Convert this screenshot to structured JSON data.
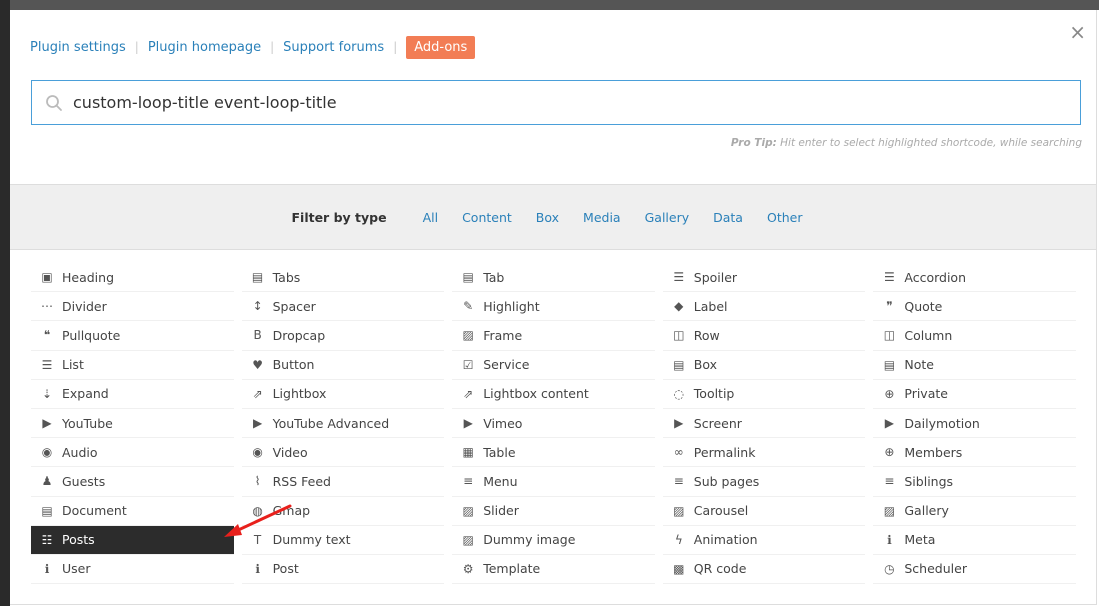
{
  "header": {
    "links": [
      "Plugin settings",
      "Plugin homepage",
      "Support forums"
    ],
    "addons_label": "Add-ons",
    "close_glyph": "×"
  },
  "search": {
    "value": "custom-loop-title event-loop-title",
    "icon": "search-icon"
  },
  "protip": {
    "bold": "Pro Tip:",
    "text": " Hit enter to select highlighted shortcode, while searching"
  },
  "filter": {
    "label": "Filter by type",
    "types": [
      "All",
      "Content",
      "Box",
      "Media",
      "Gallery",
      "Data",
      "Other"
    ]
  },
  "colors": {
    "link": "#2a80b9",
    "addons": "#f27d55",
    "active": "#2c2c2c",
    "arrow": "#e8201c"
  },
  "shortcodes": [
    {
      "label": "Heading",
      "icon": "heading-icon",
      "glyph": "▣"
    },
    {
      "label": "Tabs",
      "icon": "tabs-icon",
      "glyph": "▤"
    },
    {
      "label": "Tab",
      "icon": "tab-icon",
      "glyph": "▤"
    },
    {
      "label": "Spoiler",
      "icon": "list-icon",
      "glyph": "☰"
    },
    {
      "label": "Accordion",
      "icon": "list-icon",
      "glyph": "☰"
    },
    {
      "label": "Divider",
      "icon": "ellipsis-icon",
      "glyph": "⋯"
    },
    {
      "label": "Spacer",
      "icon": "arrows-v-icon",
      "glyph": "↕"
    },
    {
      "label": "Highlight",
      "icon": "pencil-icon",
      "glyph": "✎"
    },
    {
      "label": "Label",
      "icon": "tag-icon",
      "glyph": "◆"
    },
    {
      "label": "Quote",
      "icon": "quote-right-icon",
      "glyph": "❞"
    },
    {
      "label": "Pullquote",
      "icon": "quote-left-icon",
      "glyph": "❝"
    },
    {
      "label": "Dropcap",
      "icon": "bold-icon",
      "glyph": "B"
    },
    {
      "label": "Frame",
      "icon": "picture-icon",
      "glyph": "▨"
    },
    {
      "label": "Row",
      "icon": "columns-icon",
      "glyph": "◫"
    },
    {
      "label": "Column",
      "icon": "columns-icon",
      "glyph": "◫"
    },
    {
      "label": "List",
      "icon": "list-ol-icon",
      "glyph": "☰"
    },
    {
      "label": "Button",
      "icon": "heart-icon",
      "glyph": "♥"
    },
    {
      "label": "Service",
      "icon": "check-square-icon",
      "glyph": "☑"
    },
    {
      "label": "Box",
      "icon": "list-alt-icon",
      "glyph": "▤"
    },
    {
      "label": "Note",
      "icon": "list-alt-icon",
      "glyph": "▤"
    },
    {
      "label": "Expand",
      "icon": "sort-amount-icon",
      "glyph": "⇣"
    },
    {
      "label": "Lightbox",
      "icon": "external-link-icon",
      "glyph": "⇗"
    },
    {
      "label": "Lightbox content",
      "icon": "external-link-icon",
      "glyph": "⇗"
    },
    {
      "label": "Tooltip",
      "icon": "comment-icon",
      "glyph": "◌"
    },
    {
      "label": "Private",
      "icon": "lock-icon",
      "glyph": "⊕"
    },
    {
      "label": "YouTube",
      "icon": "youtube-play-icon",
      "glyph": "▶"
    },
    {
      "label": "YouTube Advanced",
      "icon": "youtube-play-icon",
      "glyph": "▶"
    },
    {
      "label": "Vimeo",
      "icon": "youtube-play-icon",
      "glyph": "▶"
    },
    {
      "label": "Screenr",
      "icon": "youtube-play-icon",
      "glyph": "▶"
    },
    {
      "label": "Dailymotion",
      "icon": "youtube-play-icon",
      "glyph": "▶"
    },
    {
      "label": "Audio",
      "icon": "play-circle-icon",
      "glyph": "◉"
    },
    {
      "label": "Video",
      "icon": "play-circle-icon",
      "glyph": "◉"
    },
    {
      "label": "Table",
      "icon": "table-icon",
      "glyph": "▦"
    },
    {
      "label": "Permalink",
      "icon": "link-icon",
      "glyph": "∞"
    },
    {
      "label": "Members",
      "icon": "lock-icon",
      "glyph": "⊕"
    },
    {
      "label": "Guests",
      "icon": "user-icon",
      "glyph": "♟"
    },
    {
      "label": "RSS Feed",
      "icon": "rss-icon",
      "glyph": "⌇"
    },
    {
      "label": "Menu",
      "icon": "bars-icon",
      "glyph": "≡"
    },
    {
      "label": "Sub pages",
      "icon": "bars-icon",
      "glyph": "≡"
    },
    {
      "label": "Siblings",
      "icon": "bars-icon",
      "glyph": "≡"
    },
    {
      "label": "Document",
      "icon": "file-text-icon",
      "glyph": "▤"
    },
    {
      "label": "Gmap",
      "icon": "globe-icon",
      "glyph": "◍"
    },
    {
      "label": "Slider",
      "icon": "picture-icon",
      "glyph": "▨"
    },
    {
      "label": "Carousel",
      "icon": "picture-icon",
      "glyph": "▨"
    },
    {
      "label": "Gallery",
      "icon": "picture-icon",
      "glyph": "▨"
    },
    {
      "label": "Posts",
      "icon": "th-list-icon",
      "glyph": "☷",
      "active": true
    },
    {
      "label": "Dummy text",
      "icon": "text-height-icon",
      "glyph": "T"
    },
    {
      "label": "Dummy image",
      "icon": "picture-icon",
      "glyph": "▨"
    },
    {
      "label": "Animation",
      "icon": "magic-icon",
      "glyph": "ϟ"
    },
    {
      "label": "Meta",
      "icon": "info-circle-icon",
      "glyph": "ℹ"
    },
    {
      "label": "User",
      "icon": "info-circle-icon",
      "glyph": "ℹ"
    },
    {
      "label": "Post",
      "icon": "info-circle-icon",
      "glyph": "ℹ"
    },
    {
      "label": "Template",
      "icon": "puzzle-icon",
      "glyph": "⚙"
    },
    {
      "label": "QR code",
      "icon": "qrcode-icon",
      "glyph": "▩"
    },
    {
      "label": "Scheduler",
      "icon": "clock-icon",
      "glyph": "◷"
    }
  ]
}
